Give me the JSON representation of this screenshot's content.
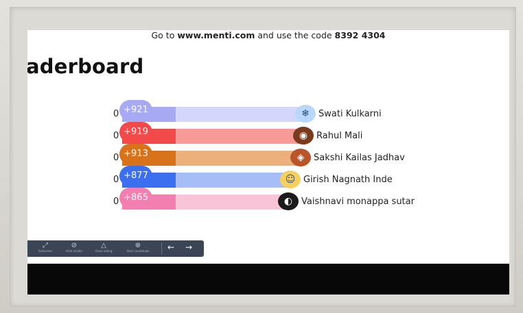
{
  "join": {
    "prefix": "Go to ",
    "url": "www.menti.com",
    "middle": " and use the code ",
    "code": "8392 4304"
  },
  "title": "aderboard",
  "leaderboard": [
    {
      "score": "+921",
      "zero": "0",
      "name": "Swati Kulkarni",
      "color": "#a7aaf3",
      "light": "#d5d6fb",
      "avatar": "snowflake-avatar",
      "fill": 0.72
    },
    {
      "score": "+919",
      "zero": "0",
      "name": "Rahul Mali",
      "color": "#f24a4a",
      "light": "#f79a98",
      "avatar": "football-avatar",
      "fill": 0.71
    },
    {
      "score": "+913",
      "zero": "0",
      "name": "Sakshi Kailas Jadhav",
      "color": "#d9731b",
      "light": "#ecb07c",
      "avatar": "cat-avatar",
      "fill": 0.7
    },
    {
      "score": "+877",
      "zero": "0",
      "name": "Girish Nagnath Inde",
      "color": "#3b6ff0",
      "light": "#a6bdf7",
      "avatar": "face-avatar",
      "fill": 0.66
    },
    {
      "score": "+865",
      "zero": "0",
      "name": "Vaishnavi monappa sutar",
      "color": "#f37fb0",
      "light": "#f9c3d8",
      "avatar": "penguin-avatar",
      "fill": 0.65
    }
  ],
  "toolbar": {
    "items": [
      {
        "icon": "⤢",
        "label": "Fullscreen"
      },
      {
        "icon": "⊘",
        "label": "Hide results"
      },
      {
        "icon": "△",
        "label": "Close voting"
      },
      {
        "icon": "⊕",
        "label": "Start countdown"
      }
    ],
    "prev": "←",
    "next": "→"
  }
}
